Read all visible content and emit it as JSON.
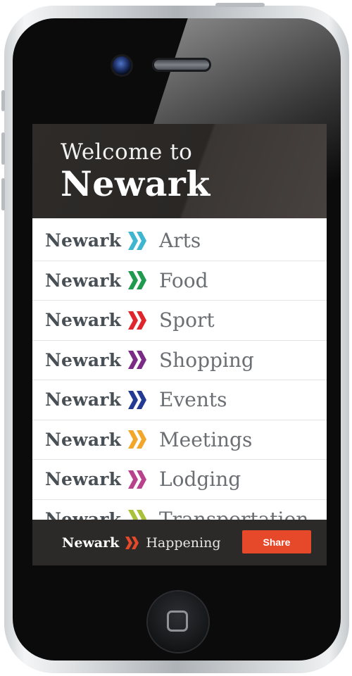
{
  "welcome": {
    "line1": "Welcome to",
    "line2": "Newark"
  },
  "menu": {
    "items": [
      {
        "brand": "Newark",
        "label": "Arts",
        "color": "#3fb6cf"
      },
      {
        "brand": "Newark",
        "label": "Food",
        "color": "#1f9a4e"
      },
      {
        "brand": "Newark",
        "label": "Sport",
        "color": "#e0262d"
      },
      {
        "brand": "Newark",
        "label": "Shopping",
        "color": "#7b2b86"
      },
      {
        "brand": "Newark",
        "label": "Events",
        "color": "#233a92"
      },
      {
        "brand": "Newark",
        "label": "Meetings",
        "color": "#f2a72a"
      },
      {
        "brand": "Newark",
        "label": "Lodging",
        "color": "#b8438c"
      },
      {
        "brand": "Newark",
        "label": "Transportation",
        "color": "#a9c23a"
      }
    ]
  },
  "bottom_bar": {
    "brand": "Newark",
    "label": "Happening",
    "share_label": "Share",
    "chevron_color": "#e5492a",
    "share_color": "#e5492a"
  }
}
